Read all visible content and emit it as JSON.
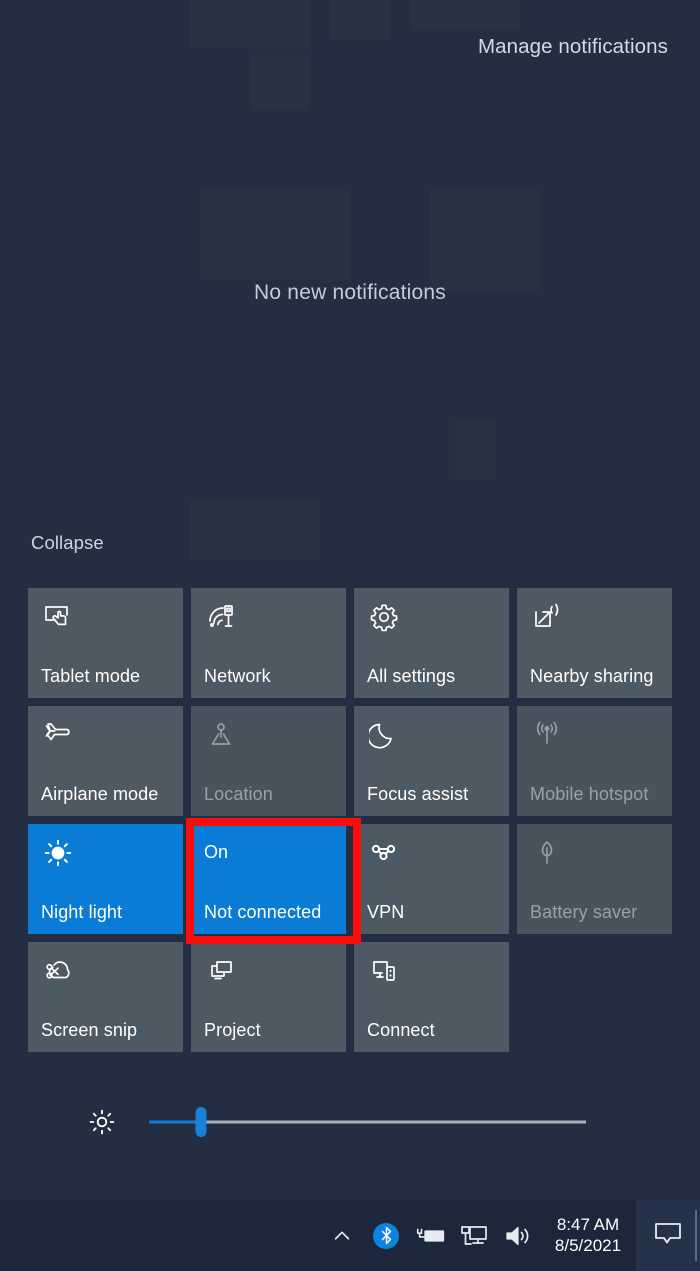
{
  "header": {
    "manage_notifications_label": "Manage notifications"
  },
  "notifications": {
    "empty_state_text": "No new notifications"
  },
  "quick_actions": {
    "collapse_label": "Collapse",
    "tiles": [
      {
        "label": "Tablet mode",
        "icon": "tablet-mode-icon",
        "state": "off",
        "status": ""
      },
      {
        "label": "Network",
        "icon": "network-wifi-icon",
        "state": "off",
        "status": ""
      },
      {
        "label": "All settings",
        "icon": "gear-icon",
        "state": "off",
        "status": ""
      },
      {
        "label": "Nearby sharing",
        "icon": "nearby-sharing-icon",
        "state": "off",
        "status": ""
      },
      {
        "label": "Airplane mode",
        "icon": "airplane-icon",
        "state": "off",
        "status": ""
      },
      {
        "label": "Location",
        "icon": "location-icon",
        "state": "dim",
        "status": ""
      },
      {
        "label": "Focus assist",
        "icon": "moon-icon",
        "state": "off",
        "status": ""
      },
      {
        "label": "Mobile hotspot",
        "icon": "hotspot-icon",
        "state": "dim",
        "status": ""
      },
      {
        "label": "Night light",
        "icon": "brightness-sun-icon",
        "state": "on",
        "status": ""
      },
      {
        "label": "Not connected",
        "icon": "",
        "state": "on",
        "status": "On"
      },
      {
        "label": "VPN",
        "icon": "vpn-icon",
        "state": "off",
        "status": ""
      },
      {
        "label": "Battery saver",
        "icon": "leaf-icon",
        "state": "dim",
        "status": ""
      },
      {
        "label": "Screen snip",
        "icon": "screen-snip-icon",
        "state": "off",
        "status": ""
      },
      {
        "label": "Project",
        "icon": "project-icon",
        "state": "off",
        "status": ""
      },
      {
        "label": "Connect",
        "icon": "connect-icon",
        "state": "off",
        "status": ""
      }
    ],
    "highlighted_tile_index": 9
  },
  "brightness": {
    "icon": "brightness-sun-icon",
    "value_percent": 12
  },
  "taskbar": {
    "show_hidden_icons": "chevron-up-icon",
    "tray_icons": [
      "bluetooth-icon",
      "battery-charging-icon",
      "network-monitor-icon",
      "volume-icon"
    ],
    "clock_time": "8:47 AM",
    "clock_date": "8/5/2021",
    "action_center_icon": "action-center-icon"
  },
  "colors": {
    "panel_background": "#232e42",
    "tile_background": "#4e5a63",
    "tile_dim_background": "#48535d",
    "accent_blue": "#0a7cd6",
    "highlight_red": "#fc0d0d",
    "taskbar_background": "#1c273b",
    "text_primary": "#ffffff",
    "text_muted": "#97a1ab"
  }
}
